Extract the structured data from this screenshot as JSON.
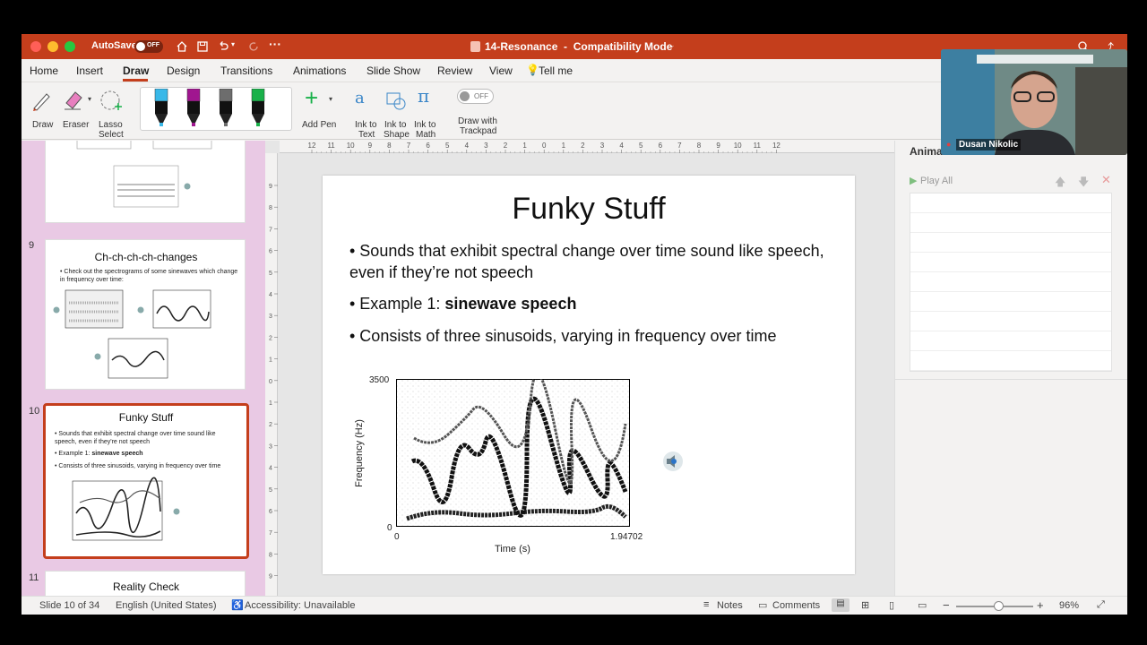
{
  "titlebar": {
    "autosave_label": "AutoSave",
    "autosave_state": "OFF",
    "doc_title": "14-Resonance  -  Compatibility Mode"
  },
  "tabs": [
    "Home",
    "Insert",
    "Draw",
    "Design",
    "Transitions",
    "Animations",
    "Slide Show",
    "Review",
    "View",
    "Tell me"
  ],
  "active_tab": "Draw",
  "ribbon": {
    "draw": "Draw",
    "eraser": "Eraser",
    "lasso_1": "Lasso",
    "lasso_2": "Select",
    "add_pen": "Add Pen",
    "ink_text_1": "Ink to",
    "ink_text_2": "Text",
    "ink_shape_1": "Ink to",
    "ink_shape_2": "Shape",
    "ink_math_1": "Ink to",
    "ink_math_2": "Math",
    "trackpad_state": "OFF",
    "trackpad_1": "Draw with",
    "trackpad_2": "Trackpad",
    "pen_colors": [
      "#39b8e8",
      "#a0168f",
      "#6d6d6d",
      "#19b14a"
    ]
  },
  "thumbnails": {
    "n9": "9",
    "n10": "10",
    "n11": "11",
    "t9_title": "Ch-ch-ch-ch-changes",
    "t9_body": "• Check out the spectrograms of some sinewaves which change in frequency over time:",
    "t10_title": "Funky Stuff",
    "t10_b1": "• Sounds that exhibit spectral change over time sound like speech, even if they're not speech",
    "t10_b2_pre": "• Example 1: ",
    "t10_b2_bold": "sinewave speech",
    "t10_b3": "• Consists of three sinusoids, varying in frequency over time",
    "t11_title": "Reality Check"
  },
  "ruler": {
    "h_labels": [
      "12",
      "11",
      "10",
      "9",
      "8",
      "7",
      "6",
      "5",
      "4",
      "3",
      "2",
      "1",
      "0",
      "1",
      "2",
      "3",
      "4",
      "5",
      "6",
      "7",
      "8",
      "9",
      "10",
      "11",
      "12"
    ],
    "v_labels": [
      "9",
      "8",
      "7",
      "6",
      "5",
      "4",
      "3",
      "2",
      "1",
      "0",
      "1",
      "2",
      "3",
      "4",
      "5",
      "6",
      "7",
      "8",
      "9"
    ]
  },
  "slide": {
    "title": "Funky Stuff",
    "bullet1": "• Sounds that exhibit spectral change over time sound like speech, even if they’re not speech",
    "bullet2_pre": "• Example 1: ",
    "bullet2_bold": "sinewave speech",
    "bullet3": "• Consists of three sinusoids, varying in frequency over time",
    "spectrogram": {
      "ylabel": "Frequency (Hz)",
      "xlabel": "Time (s)",
      "y_max": "3500",
      "y_min": "0",
      "x_min": "0",
      "x_max": "1.94702"
    }
  },
  "animation_pane": {
    "title": "Animation",
    "play_all": "Play All"
  },
  "video": {
    "name": "Dusan Nikolic"
  },
  "status": {
    "slide": "Slide 10 of 34",
    "language": "English (United States)",
    "accessibility": "Accessibility: Unavailable",
    "notes": "Notes",
    "comments": "Comments",
    "zoom": "96%",
    "zoom_level": 0.55
  }
}
